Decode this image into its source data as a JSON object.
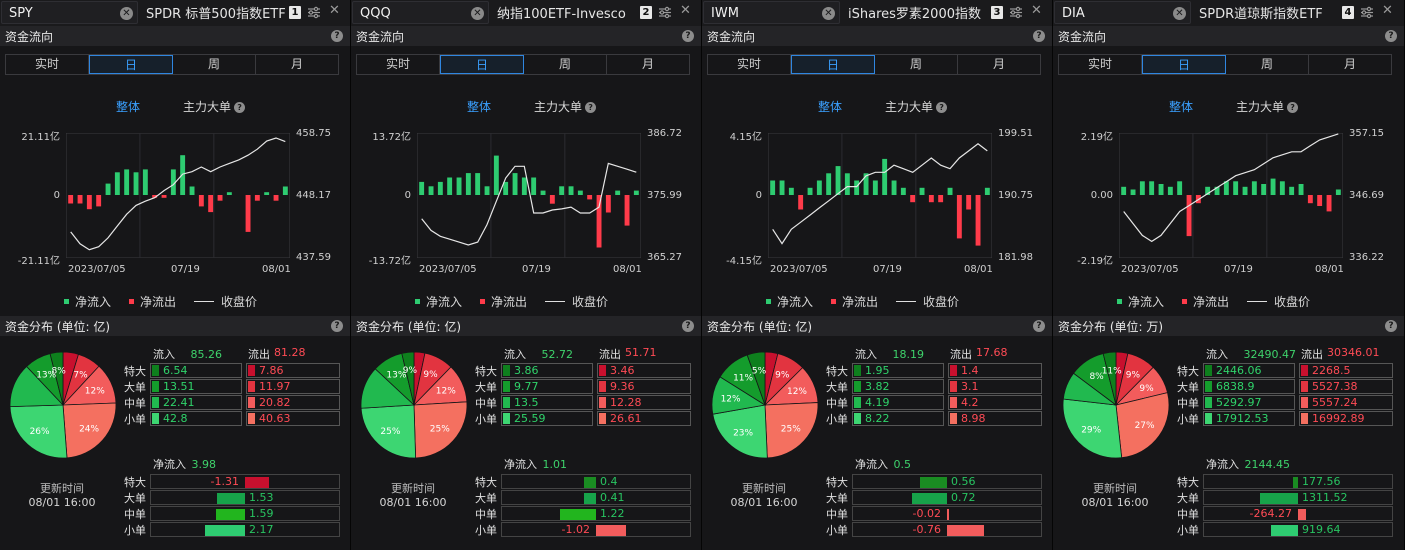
{
  "colors": {
    "inflow": "#2ecc71",
    "outflow": "#ff3b4a",
    "accent": "#3aa0ff",
    "price_line": "#e6e6e6",
    "pie": [
      "#c8102e",
      "#e23440",
      "#f25c5c",
      "#f47060",
      "#3dd672",
      "#21b94f",
      "#149c2c",
      "#0e7f1d"
    ],
    "cells_in": [
      "#0e7f1d",
      "#149c2c",
      "#21b94f",
      "#3dd672"
    ],
    "cells_out": [
      "#c8102e",
      "#e23440",
      "#f25c5c",
      "#f47060"
    ]
  },
  "common": {
    "sec_fund_flow": "资金流向",
    "tabs": [
      "实时",
      "日",
      "周",
      "月"
    ],
    "active_tab": 1,
    "view_whole": "整体",
    "view_major": "主力大单",
    "legend_in": "净流入",
    "legend_out": "净流出",
    "legend_price": "收盘价",
    "flow_in_label": "流入",
    "flow_out_label": "流出",
    "order_types": [
      "特大",
      "大单",
      "中单",
      "小单"
    ],
    "net_label": "净流入",
    "update_label": "更新时间",
    "update_time": "08/01 16:00",
    "x_labels": [
      "2023/07/05",
      "07/19",
      "08/01"
    ],
    "icons": {
      "clear": "clear-icon",
      "settings": "settings-icon",
      "close": "close-icon",
      "help": "help-icon"
    }
  },
  "panels": [
    {
      "ticker": "SPY",
      "name": "SPDR 标普500指数ETF",
      "badge": "1",
      "dist_title": "资金分布 (单位: 亿)",
      "y_left": [
        "21.11亿",
        "0",
        "-21.11亿"
      ],
      "y_right": [
        "458.75",
        "448.17",
        "437.59"
      ],
      "chart_data": {
        "type": "bar",
        "flow_max": 21.11,
        "price_range": [
          437.59,
          458.75
        ],
        "flows": [
          -3,
          -3,
          -5,
          -4,
          4,
          8,
          9,
          8,
          9,
          -1,
          -1,
          9,
          14,
          3,
          -4,
          -6,
          -2,
          1,
          0,
          -13,
          -2,
          1,
          -2,
          3
        ],
        "prices": [
          442,
          440,
          439,
          439.5,
          441,
          443,
          445,
          446.5,
          447.2,
          447.8,
          449,
          450,
          451.8,
          452.2,
          453,
          452.2,
          453,
          453.6,
          454.2,
          455,
          456,
          457.4,
          457.9,
          457.3
        ]
      },
      "flow_in_total": "85.26",
      "flow_out_total": "81.28",
      "flow_in": [
        "6.54",
        "13.51",
        "22.41",
        "42.8"
      ],
      "flow_out": [
        "7.86",
        "11.97",
        "20.82",
        "40.63"
      ],
      "pie_pct": [
        "7%",
        "12%",
        "24%",
        "26%",
        "13%",
        "8%"
      ],
      "pie_values": [
        7.86,
        11.97,
        20.82,
        40.63,
        42.8,
        22.41,
        13.51,
        6.54
      ],
      "net_total": "3.98",
      "net_values": [
        "-1.31",
        "1.53",
        "1.59",
        "2.17"
      ],
      "net_nums": [
        -1.31,
        1.53,
        1.59,
        2.17
      ],
      "net_scale": 2.4
    },
    {
      "ticker": "QQQ",
      "name": "纳指100ETF-Invesco",
      "badge": "2",
      "dist_title": "资金分布 (单位: 亿)",
      "y_left": [
        "13.72亿",
        "0",
        "-13.72亿"
      ],
      "y_right": [
        "386.72",
        "375.99",
        "365.27"
      ],
      "chart_data": {
        "type": "bar",
        "flow_max": 13.72,
        "price_range": [
          365.27,
          386.72
        ],
        "flows": [
          3,
          2,
          3,
          4,
          4,
          5,
          5,
          2,
          9,
          3,
          5,
          4,
          4,
          1,
          -2,
          2,
          2,
          1,
          -1,
          -12,
          -4,
          1,
          -7,
          1
        ],
        "prices": [
          372,
          370,
          369,
          368.5,
          368,
          367.5,
          368,
          371,
          375,
          379,
          381,
          381,
          373,
          373,
          373.5,
          373.7,
          374,
          373,
          373,
          374,
          381.5,
          381,
          380.5,
          380
        ]
      },
      "flow_in_total": "52.72",
      "flow_out_total": "51.71",
      "flow_in": [
        "3.86",
        "9.77",
        "13.5",
        "25.59"
      ],
      "flow_out": [
        "3.46",
        "9.36",
        "12.28",
        "26.61"
      ],
      "pie_pct": [
        "9%",
        "12%",
        "25%",
        "25%",
        "13%",
        "9%"
      ],
      "pie_values": [
        3.46,
        9.36,
        12.28,
        26.61,
        25.59,
        13.5,
        9.77,
        3.86
      ],
      "net_total": "1.01",
      "net_values": [
        "0.4",
        "0.41",
        "1.22",
        "-1.02"
      ],
      "net_nums": [
        0.4,
        0.41,
        1.22,
        -1.02
      ],
      "net_scale": 1.5
    },
    {
      "ticker": "IWM",
      "name": "iShares罗素2000指数",
      "badge": "3",
      "dist_title": "资金分布 (单位: 亿)",
      "y_left": [
        "4.15亿",
        "0",
        "-4.15亿"
      ],
      "y_right": [
        "199.51",
        "190.75",
        "181.98"
      ],
      "chart_data": {
        "type": "bar",
        "flow_max": 4.15,
        "price_range": [
          181.98,
          199.51
        ],
        "flows": [
          1,
          1,
          0.5,
          -1,
          0.5,
          1,
          1.5,
          2,
          1.5,
          1,
          1.5,
          1,
          2.5,
          1,
          0.5,
          -0.5,
          0.5,
          -0.5,
          -0.5,
          0.5,
          -3,
          -1,
          -3.5,
          0.5
        ],
        "prices": [
          186,
          184,
          186,
          187,
          188,
          189,
          190,
          191,
          192,
          192,
          193.5,
          194,
          194,
          195,
          194.5,
          194,
          195,
          196,
          195,
          194.5,
          196,
          197,
          198,
          197
        ]
      },
      "flow_in_total": "18.19",
      "flow_out_total": "17.68",
      "flow_in": [
        "1.95",
        "3.82",
        "4.19",
        "8.22"
      ],
      "flow_out": [
        "1.4",
        "3.1",
        "4.2",
        "8.98"
      ],
      "pie_pct": [
        "9%",
        "12%",
        "25%",
        "23%",
        "12%",
        "11%",
        "5%"
      ],
      "pie_values": [
        1.4,
        3.1,
        4.2,
        8.98,
        8.22,
        4.19,
        3.82,
        1.95
      ],
      "net_total": "0.5",
      "net_values": [
        "0.56",
        "0.72",
        "-0.02",
        "-0.76"
      ],
      "net_nums": [
        0.56,
        0.72,
        -0.02,
        -0.76
      ],
      "net_scale": 0.9
    },
    {
      "ticker": "DIA",
      "name": "SPDR道琼斯指数ETF",
      "badge": "4",
      "dist_title": "资金分布 (单位: 万)",
      "y_left": [
        "2.19亿",
        "0.00",
        "-2.19亿"
      ],
      "y_right": [
        "357.15",
        "346.69",
        "336.22"
      ],
      "chart_data": {
        "type": "bar",
        "flow_max": 2.19,
        "price_range": [
          336.22,
          357.15
        ],
        "flows": [
          0.3,
          0.2,
          0.5,
          0.5,
          0.4,
          0.3,
          0.5,
          -1.5,
          -0.3,
          0.3,
          0.3,
          0.5,
          0.5,
          0.3,
          0.5,
          0.4,
          0.6,
          0.5,
          0.3,
          0.4,
          -0.3,
          -0.4,
          -0.6,
          0.2
        ],
        "prices": [
          344,
          342,
          340,
          339,
          340,
          342,
          344,
          345,
          346,
          347,
          348,
          349,
          350,
          350.5,
          351,
          352,
          353,
          353.5,
          354,
          354,
          355,
          356,
          356.5,
          357
        ]
      },
      "flow_in_total": "32490.47",
      "flow_out_total": "30346.01",
      "flow_in": [
        "2446.06",
        "6838.9",
        "5292.97",
        "17912.53"
      ],
      "flow_out": [
        "2268.5",
        "5527.38",
        "5557.24",
        "16992.89"
      ],
      "pie_pct": [
        "9%",
        "9%",
        "27%",
        "29%",
        "8%",
        "11%"
      ],
      "pie_values": [
        2268.5,
        5527.38,
        5557.24,
        16992.89,
        17912.53,
        5292.97,
        6838.9,
        2446.06
      ],
      "net_total": "2144.45",
      "net_values": [
        "177.56",
        "1311.52",
        "-264.27",
        "919.64"
      ],
      "net_nums": [
        177.56,
        1311.52,
        -264.27,
        919.64
      ],
      "net_scale": 1500
    }
  ]
}
